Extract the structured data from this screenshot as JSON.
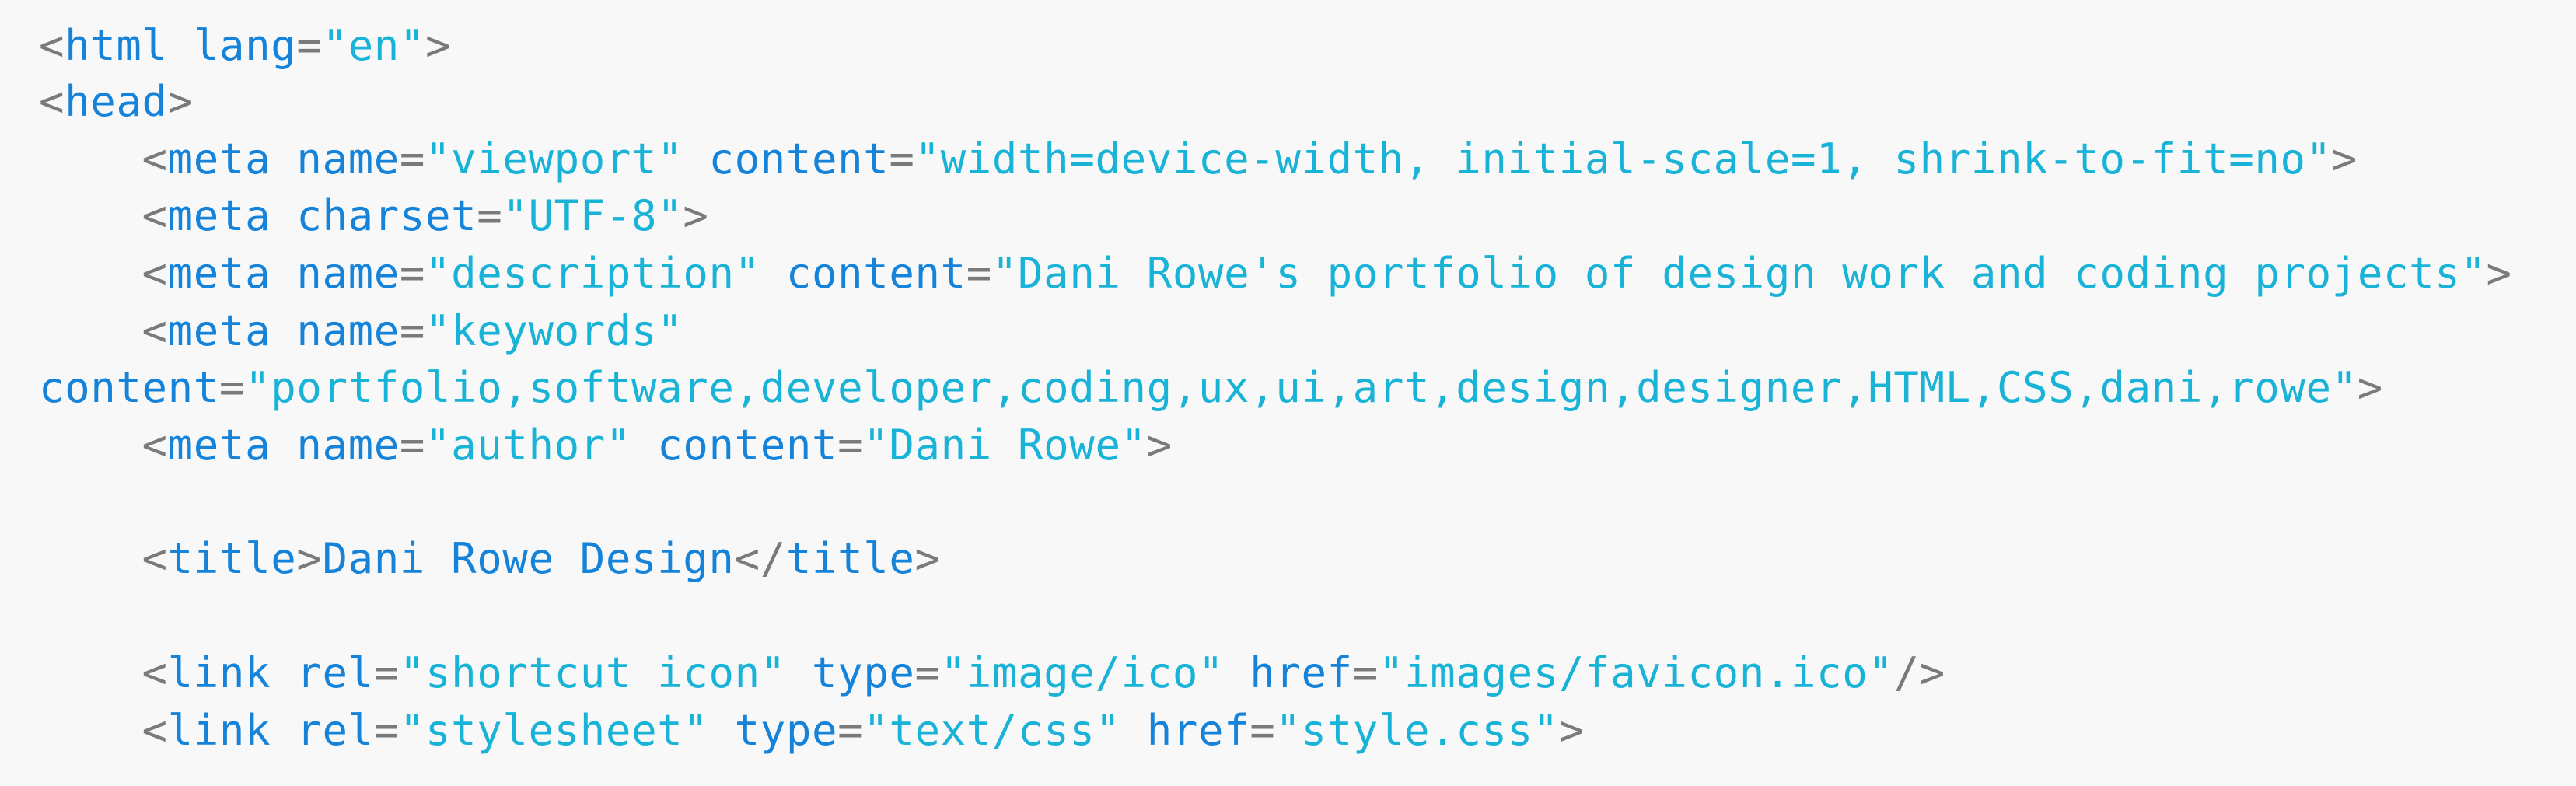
{
  "colors": {
    "background": "#f8f8f8",
    "punctuation": "#7a7a7a",
    "tag": "#1583d9",
    "attribute": "#1583d9",
    "value": "#19b3d8",
    "text": "#1583d9"
  },
  "code_lines": [
    {
      "indent": "",
      "tokens": [
        {
          "kind": "p",
          "text": "<"
        },
        {
          "kind": "t",
          "text": "html"
        },
        {
          "kind": "p",
          "text": " "
        },
        {
          "kind": "a",
          "text": "lang"
        },
        {
          "kind": "p",
          "text": "="
        },
        {
          "kind": "v",
          "text": "\"en\""
        },
        {
          "kind": "p",
          "text": ">"
        }
      ]
    },
    {
      "indent": "",
      "tokens": [
        {
          "kind": "p",
          "text": "<"
        },
        {
          "kind": "t",
          "text": "head"
        },
        {
          "kind": "p",
          "text": ">"
        }
      ]
    },
    {
      "indent": "    ",
      "tokens": [
        {
          "kind": "p",
          "text": "<"
        },
        {
          "kind": "t",
          "text": "meta"
        },
        {
          "kind": "p",
          "text": " "
        },
        {
          "kind": "a",
          "text": "name"
        },
        {
          "kind": "p",
          "text": "="
        },
        {
          "kind": "v",
          "text": "\"viewport\""
        },
        {
          "kind": "p",
          "text": " "
        },
        {
          "kind": "a",
          "text": "content"
        },
        {
          "kind": "p",
          "text": "="
        },
        {
          "kind": "v",
          "text": "\"width=device-width, initial-scale=1, shrink-to-fit=no\""
        },
        {
          "kind": "p",
          "text": ">"
        }
      ]
    },
    {
      "indent": "    ",
      "tokens": [
        {
          "kind": "p",
          "text": "<"
        },
        {
          "kind": "t",
          "text": "meta"
        },
        {
          "kind": "p",
          "text": " "
        },
        {
          "kind": "a",
          "text": "charset"
        },
        {
          "kind": "p",
          "text": "="
        },
        {
          "kind": "v",
          "text": "\"UTF-8\""
        },
        {
          "kind": "p",
          "text": ">"
        }
      ]
    },
    {
      "indent": "    ",
      "tokens": [
        {
          "kind": "p",
          "text": "<"
        },
        {
          "kind": "t",
          "text": "meta"
        },
        {
          "kind": "p",
          "text": " "
        },
        {
          "kind": "a",
          "text": "name"
        },
        {
          "kind": "p",
          "text": "="
        },
        {
          "kind": "v",
          "text": "\"description\""
        },
        {
          "kind": "p",
          "text": " "
        },
        {
          "kind": "a",
          "text": "content"
        },
        {
          "kind": "p",
          "text": "="
        },
        {
          "kind": "v",
          "text": "\"Dani Rowe's portfolio of design work and coding projects\""
        },
        {
          "kind": "p",
          "text": ">"
        }
      ]
    },
    {
      "indent": "    ",
      "tokens": [
        {
          "kind": "p",
          "text": "<"
        },
        {
          "kind": "t",
          "text": "meta"
        },
        {
          "kind": "p",
          "text": " "
        },
        {
          "kind": "a",
          "text": "name"
        },
        {
          "kind": "p",
          "text": "="
        },
        {
          "kind": "v",
          "text": "\"keywords\""
        }
      ]
    },
    {
      "indent": "",
      "tokens": [
        {
          "kind": "a",
          "text": "content"
        },
        {
          "kind": "p",
          "text": "="
        },
        {
          "kind": "v",
          "text": "\"portfolio,software,developer,coding,ux,ui,art,design,designer,HTML,CSS,dani,rowe\""
        },
        {
          "kind": "p",
          "text": ">"
        }
      ]
    },
    {
      "indent": "    ",
      "tokens": [
        {
          "kind": "p",
          "text": "<"
        },
        {
          "kind": "t",
          "text": "meta"
        },
        {
          "kind": "p",
          "text": " "
        },
        {
          "kind": "a",
          "text": "name"
        },
        {
          "kind": "p",
          "text": "="
        },
        {
          "kind": "v",
          "text": "\"author\""
        },
        {
          "kind": "p",
          "text": " "
        },
        {
          "kind": "a",
          "text": "content"
        },
        {
          "kind": "p",
          "text": "="
        },
        {
          "kind": "v",
          "text": "\"Dani Rowe\""
        },
        {
          "kind": "p",
          "text": ">"
        }
      ]
    },
    {
      "indent": "",
      "tokens": []
    },
    {
      "indent": "    ",
      "tokens": [
        {
          "kind": "p",
          "text": "<"
        },
        {
          "kind": "t",
          "text": "title"
        },
        {
          "kind": "p",
          "text": ">"
        },
        {
          "kind": "x",
          "text": "Dani Rowe Design"
        },
        {
          "kind": "p",
          "text": "</"
        },
        {
          "kind": "t",
          "text": "title"
        },
        {
          "kind": "p",
          "text": ">"
        }
      ]
    },
    {
      "indent": "",
      "tokens": []
    },
    {
      "indent": "    ",
      "tokens": [
        {
          "kind": "p",
          "text": "<"
        },
        {
          "kind": "t",
          "text": "link"
        },
        {
          "kind": "p",
          "text": " "
        },
        {
          "kind": "a",
          "text": "rel"
        },
        {
          "kind": "p",
          "text": "="
        },
        {
          "kind": "v",
          "text": "\"shortcut icon\""
        },
        {
          "kind": "p",
          "text": " "
        },
        {
          "kind": "a",
          "text": "type"
        },
        {
          "kind": "p",
          "text": "="
        },
        {
          "kind": "v",
          "text": "\"image/ico\""
        },
        {
          "kind": "p",
          "text": " "
        },
        {
          "kind": "a",
          "text": "href"
        },
        {
          "kind": "p",
          "text": "="
        },
        {
          "kind": "v",
          "text": "\"images/favicon.ico\""
        },
        {
          "kind": "p",
          "text": "/>"
        }
      ]
    },
    {
      "indent": "    ",
      "tokens": [
        {
          "kind": "p",
          "text": "<"
        },
        {
          "kind": "t",
          "text": "link"
        },
        {
          "kind": "p",
          "text": " "
        },
        {
          "kind": "a",
          "text": "rel"
        },
        {
          "kind": "p",
          "text": "="
        },
        {
          "kind": "v",
          "text": "\"stylesheet\""
        },
        {
          "kind": "p",
          "text": " "
        },
        {
          "kind": "a",
          "text": "type"
        },
        {
          "kind": "p",
          "text": "="
        },
        {
          "kind": "v",
          "text": "\"text/css\""
        },
        {
          "kind": "p",
          "text": " "
        },
        {
          "kind": "a",
          "text": "href"
        },
        {
          "kind": "p",
          "text": "="
        },
        {
          "kind": "v",
          "text": "\"style.css\""
        },
        {
          "kind": "p",
          "text": ">"
        }
      ]
    }
  ]
}
